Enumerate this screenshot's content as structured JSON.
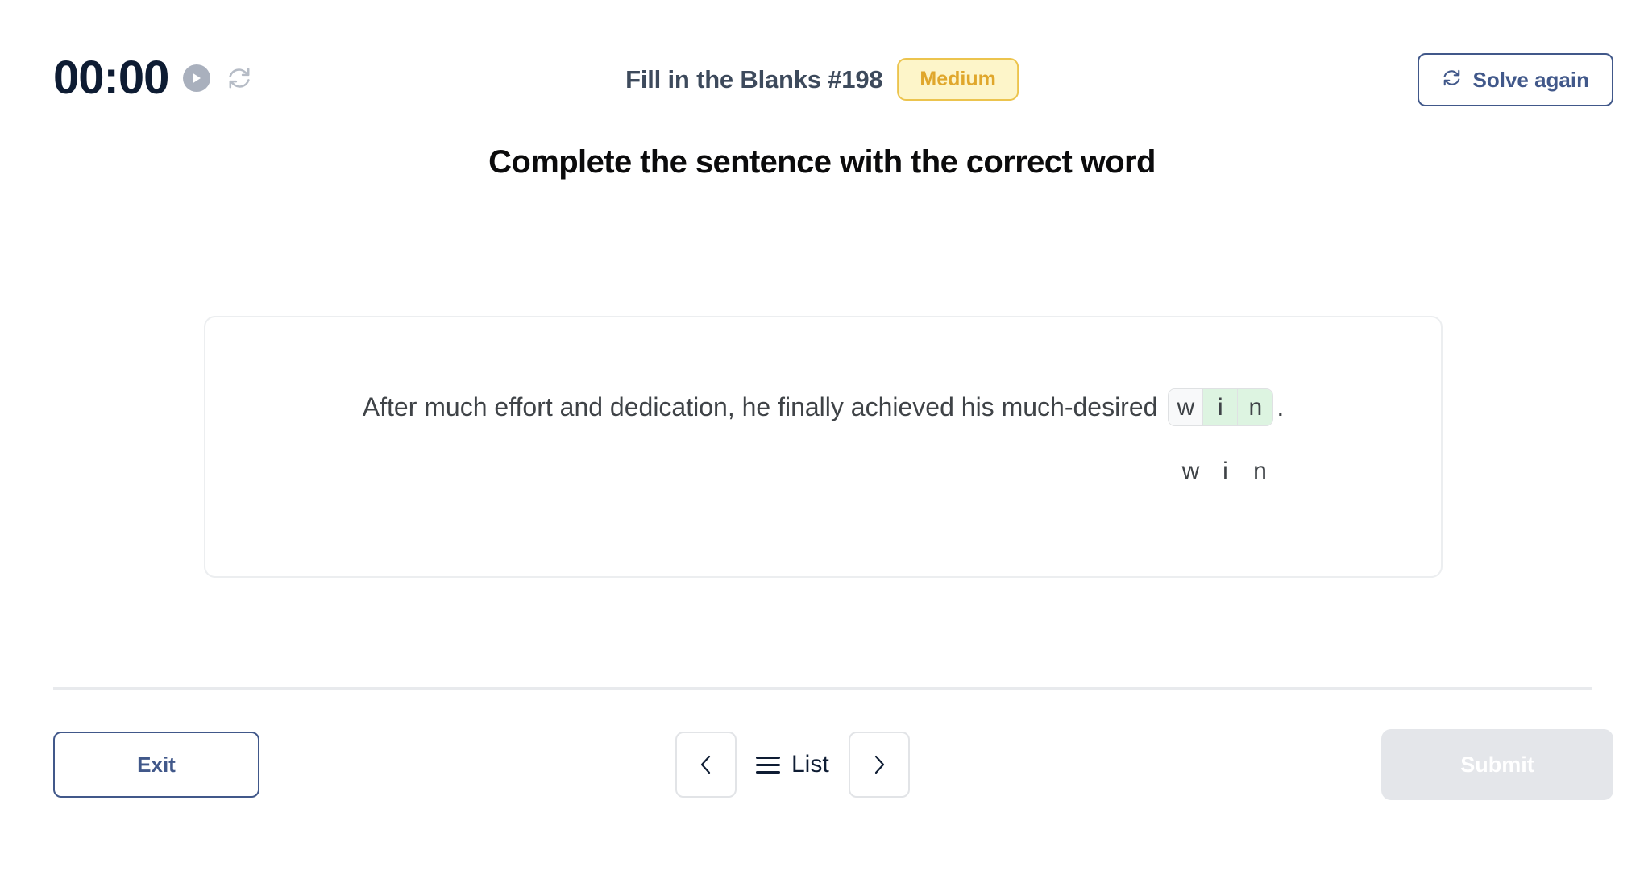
{
  "header": {
    "timer": "00:00",
    "play_icon": "play-icon",
    "reset_icon": "reset-icon",
    "quiz_title": "Fill in the Blanks #198",
    "difficulty": "Medium",
    "solve_again_label": "Solve again",
    "solve_again_icon": "refresh-icon"
  },
  "heading": "Complete the sentence with the correct word",
  "question": {
    "sentence_before": "After much effort and dedication, he finally achieved his much-desired ",
    "sentence_after": ".",
    "answer_word": "win",
    "blanks": [
      {
        "letter": "w",
        "state": "empty"
      },
      {
        "letter": "i",
        "state": "filled"
      },
      {
        "letter": "n",
        "state": "filled"
      }
    ],
    "letter_bank": [
      "w",
      "i",
      "n"
    ]
  },
  "footer": {
    "exit_label": "Exit",
    "prev_icon": "chevron-left-icon",
    "next_icon": "chevron-right-icon",
    "list_label": "List",
    "list_icon": "hamburger-icon",
    "submit_label": "Submit",
    "submit_disabled": true
  },
  "colors": {
    "timer_navy": "#0e1c33",
    "title_slate": "#3d4a5c",
    "badge_text": "#e0a72c",
    "badge_bg": "#fdf5c9",
    "badge_border": "#ecc44e",
    "accent_navy": "#41588a",
    "filled_cell": "#ddf4e1",
    "empty_cell": "#f8f9fa",
    "card_border": "#eceef0",
    "submit_disabled_bg": "#e4e6ea"
  }
}
